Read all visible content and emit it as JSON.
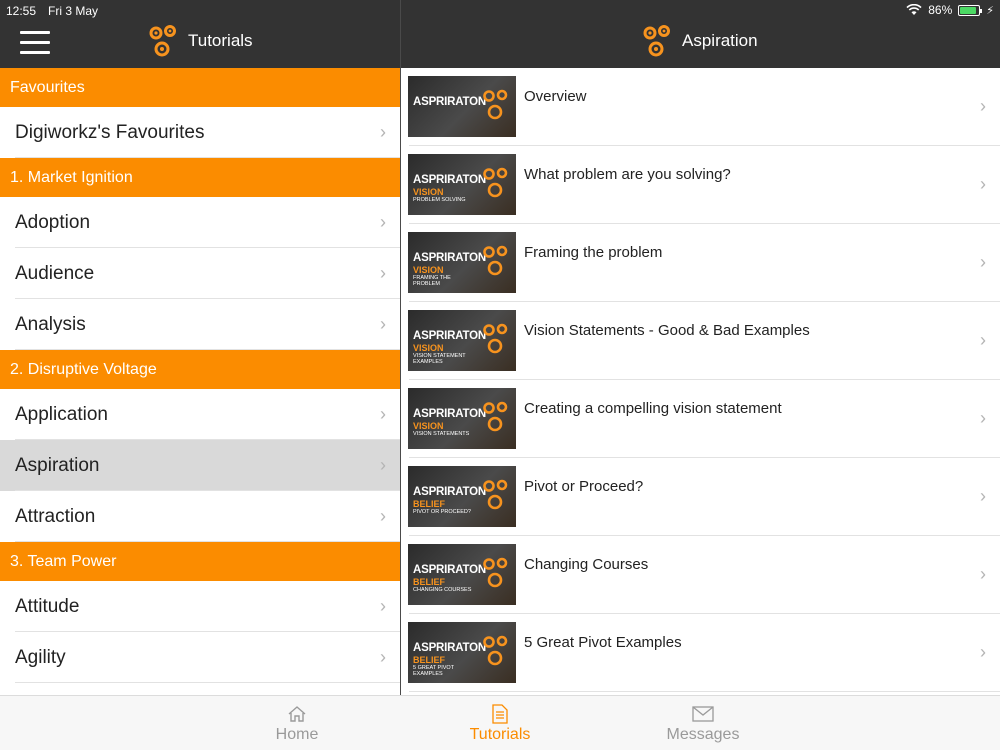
{
  "status": {
    "time": "12:55",
    "date": "Fri 3 May",
    "battery": "86%",
    "battery_level": 0.86
  },
  "left_header": {
    "title": "Tutorials"
  },
  "right_header": {
    "title": "Aspiration"
  },
  "left_list": [
    {
      "type": "section",
      "label": "Favourites"
    },
    {
      "type": "row",
      "label": "Digiworkz's Favourites"
    },
    {
      "type": "section",
      "label": "1. Market Ignition"
    },
    {
      "type": "row",
      "label": "Adoption"
    },
    {
      "type": "row",
      "label": "Audience"
    },
    {
      "type": "row",
      "label": "Analysis"
    },
    {
      "type": "section",
      "label": "2. Disruptive Voltage"
    },
    {
      "type": "row",
      "label": "Application"
    },
    {
      "type": "row",
      "label": "Aspiration",
      "selected": true
    },
    {
      "type": "row",
      "label": "Attraction"
    },
    {
      "type": "section",
      "label": "3. Team Power"
    },
    {
      "type": "row",
      "label": "Attitude"
    },
    {
      "type": "row",
      "label": "Agility"
    }
  ],
  "videos": [
    {
      "title": "Overview",
      "thumb": {
        "brand": "ASPRIRATON",
        "tag": "",
        "sub": ""
      }
    },
    {
      "title": "What problem are you solving?",
      "thumb": {
        "brand": "ASPRIRATON",
        "tag": "VISION",
        "sub": "PROBLEM SOLVING"
      }
    },
    {
      "title": "Framing the problem",
      "thumb": {
        "brand": "ASPRIRATON",
        "tag": "VISION",
        "sub": "FRAMING THE PROBLEM"
      }
    },
    {
      "title": "Vision Statements - Good & Bad Examples",
      "thumb": {
        "brand": "ASPRIRATON",
        "tag": "VISION",
        "sub": "VISION STATEMENT EXAMPLES"
      }
    },
    {
      "title": "Creating a compelling vision statement",
      "thumb": {
        "brand": "ASPRIRATON",
        "tag": "VISION",
        "sub": "VISION STATEMENTS"
      }
    },
    {
      "title": "Pivot or Proceed?",
      "thumb": {
        "brand": "ASPRIRATON",
        "tag": "BELIEF",
        "sub": "PIVOT OR PROCEED?"
      }
    },
    {
      "title": "Changing Courses",
      "thumb": {
        "brand": "ASPRIRATON",
        "tag": "BELIEF",
        "sub": "CHANGING COURSES"
      }
    },
    {
      "title": "5 Great Pivot Examples",
      "thumb": {
        "brand": "ASPRIRATON",
        "tag": "BELIEF",
        "sub": "5 GREAT PIVOT EXAMPLES"
      }
    }
  ],
  "tabs": {
    "home": "Home",
    "tutorials": "Tutorials",
    "messages": "Messages"
  },
  "colors": {
    "accent": "#fb8c00",
    "header_bg": "#333333",
    "selected_row": "#d9d9d9"
  },
  "icons": {
    "menu": "hamburger-icon",
    "logo": "gears-icon",
    "chevron": "chevron-right-icon",
    "home": "home-icon",
    "tutorials": "document-icon",
    "messages": "envelope-icon",
    "wifi": "wifi-icon",
    "battery": "battery-icon"
  }
}
